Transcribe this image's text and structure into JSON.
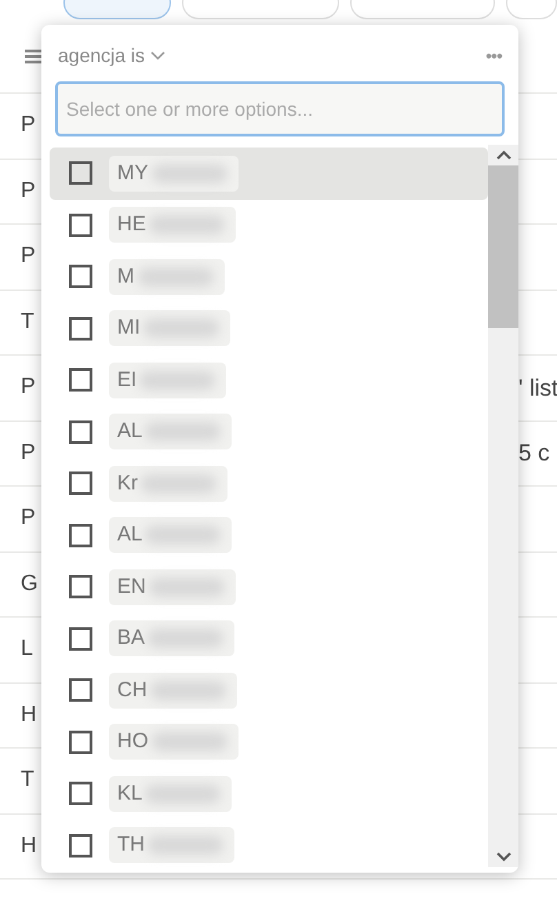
{
  "table": {
    "rows": [
      {
        "column_1": "P"
      },
      {
        "column_1": "P"
      },
      {
        "column_1": "P"
      },
      {
        "column_1": "T"
      },
      {
        "column_1": "P",
        "column_2": "' list"
      },
      {
        "column_1": "P",
        "column_2": "5 c"
      },
      {
        "column_1": "P"
      },
      {
        "column_1": "G"
      },
      {
        "column_1": "L"
      },
      {
        "column_1": "H"
      },
      {
        "column_1": "T"
      },
      {
        "column_1": "H"
      }
    ]
  },
  "filter_popup": {
    "property": "agencja is",
    "more": "•••",
    "search": {
      "placeholder": "Select one or more options..."
    },
    "options": [
      {
        "label": "MY",
        "hovered": true,
        "checked": false
      },
      {
        "label": "HE",
        "hovered": false,
        "checked": false
      },
      {
        "label": "M",
        "hovered": false,
        "checked": false
      },
      {
        "label": "MI",
        "hovered": false,
        "checked": false
      },
      {
        "label": "EI",
        "hovered": false,
        "checked": false
      },
      {
        "label": "AL",
        "hovered": false,
        "checked": false
      },
      {
        "label": "Kr",
        "hovered": false,
        "checked": false
      },
      {
        "label": "AL",
        "hovered": false,
        "checked": false
      },
      {
        "label": "EN",
        "hovered": false,
        "checked": false
      },
      {
        "label": "BA",
        "hovered": false,
        "checked": false
      },
      {
        "label": "CH",
        "hovered": false,
        "checked": false
      },
      {
        "label": "HO",
        "hovered": false,
        "checked": false
      },
      {
        "label": "KL",
        "hovered": false,
        "checked": false
      },
      {
        "label": "TH",
        "hovered": false,
        "checked": false
      }
    ]
  }
}
